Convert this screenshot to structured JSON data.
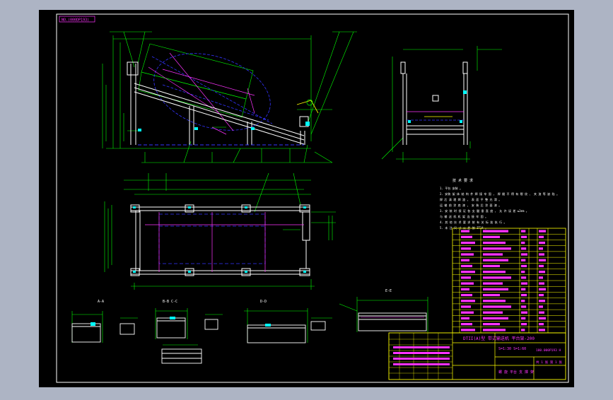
{
  "drawing": {
    "background_color": "#000000",
    "frame_color": "#ffffff",
    "colors": {
      "green": "#00ff00",
      "white": "#ffffff",
      "magenta": "#ff33ff",
      "blue": "#3333ff",
      "yellow": "#ffff00",
      "red": "#ff0000",
      "cyan": "#00ffff"
    },
    "top_left_tag": "NO.(000DP193)",
    "views": {
      "section_a": "A-A",
      "section_b": "B-B   C-C",
      "section_c": "D-D",
      "section_d": "E-E"
    },
    "tech_title": "技 术 要 求",
    "tech_notes": [
      "1. 平台 安装 。",
      "2. 安装 架 体 结 构 件 焊 接 牢 固 ， 焊 缝 不 得 有 裂 纹 、 夹 渣 等 缺 陷 。",
      "   焊 后 清 理 焊 渣 ， 表 面 平 整 光 滑 。",
      "   运 输 前 涂 底 漆 ， 安 装 后 涂 面 漆 。",
      "3. 安 装 时 保 证 各 支 腿 垂 直 度 ， 允 许 误 差 ≤2mm 。",
      "   与 输 送 机 机 架 连 接 牢 固 。",
      "4. 其 他 技 术 要 求 按 有 关 标 准 执 行 。",
      "5. 未 注 尺 寸 公 差 按 IT14 。"
    ],
    "title_block": {
      "title": "DTII(A)型 带式输送机 平台架-200",
      "drawing_number": "180.000P193 H",
      "scale_row": "S=1:30  S=1:60",
      "name_cn": "螺 旋 平台 支 撑 架",
      "sheet": "共 1 张  第 1 张"
    }
  }
}
